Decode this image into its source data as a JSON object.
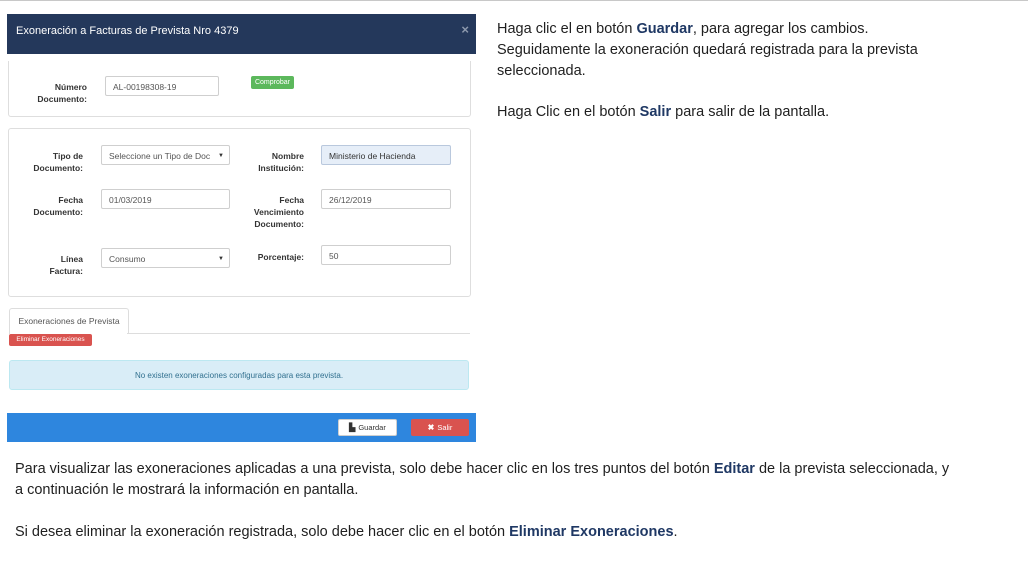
{
  "modal": {
    "title": "Exoneración a Facturas de Prevista Nro 4379",
    "close_glyph": "×",
    "numero_documento_label": "Número\nDocumento:",
    "numero_documento_value": "AL-00198308-19",
    "comprobar_label": "Comprobar",
    "tipo_documento_label": "Tipo de\nDocumento:",
    "tipo_documento_value": "Seleccione un Tipo de Doc",
    "nombre_institucion_label": "Nombre\nInstitución:",
    "nombre_institucion_value": "Ministerio de Hacienda",
    "fecha_documento_label": "Fecha\nDocumento:",
    "fecha_documento_value": "01/03/2019",
    "fecha_vencimiento_label": "Fecha\nVencimiento\nDocumento:",
    "fecha_vencimiento_value": "26/12/2019",
    "linea_factura_label": "Línea\nFactura:",
    "linea_factura_value": "Consumo",
    "porcentaje_label": "Porcentaje:",
    "porcentaje_value": "50",
    "tab_label": "Exoneraciones de Prevista",
    "eliminar_label": "Eliminar Exoneraciones",
    "empty_message": "No existen exoneraciones configuradas para esta prevista.",
    "guardar_label": "Guardar",
    "salir_label": "Salir"
  },
  "instructions": {
    "right_p1_a": "Haga clic el en botón ",
    "right_p1_b": "Guardar",
    "right_p1_c": ", para agregar los cambios.",
    "right_p1_d": "Seguidamente la exoneración quedará registrada para la prevista",
    "right_p1_e": "seleccionada.",
    "right_p2_a": "Haga Clic en el botón ",
    "right_p2_b": "Salir",
    "right_p2_c": " para salir de la pantalla.",
    "bottom_p1_a": "Para visualizar las exoneraciones aplicadas a una prevista, solo debe hacer clic en los tres puntos del botón ",
    "bottom_p1_b": "Editar",
    "bottom_p1_c": " de la prevista seleccionada, y",
    "bottom_p1_d": "a continuación le mostrará la información en pantalla.",
    "bottom_p2_a": "Si desea eliminar la exoneración registrada, solo debe hacer clic en el botón ",
    "bottom_p2_b": "Eliminar Exoneraciones",
    "bottom_p2_c": "."
  },
  "colors": {
    "header": "#24385b",
    "footer": "#2e86de",
    "highlight": "#1f3864"
  }
}
